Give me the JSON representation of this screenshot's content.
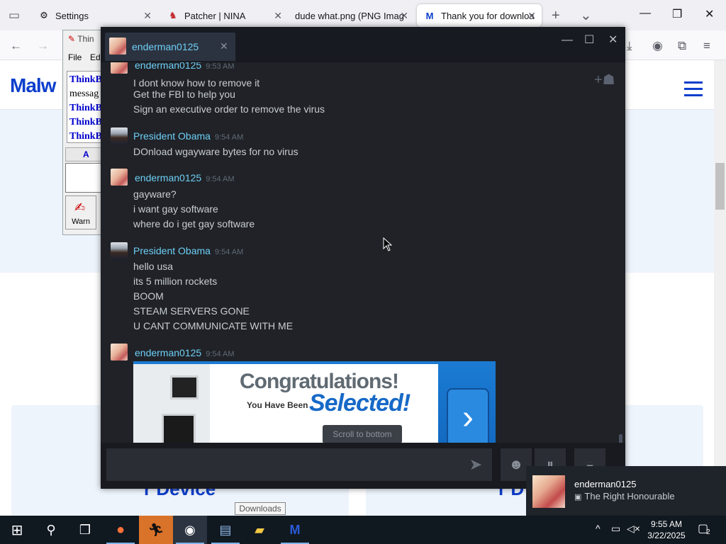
{
  "browser": {
    "tabs": [
      {
        "label": "Settings",
        "icon": "gear-icon"
      },
      {
        "label": "Patcher | NINA",
        "icon": "nina-icon"
      },
      {
        "label": "dude what.png (PNG Imag",
        "icon": "image-icon"
      },
      {
        "label": "Thank you for downloa",
        "icon": "malwarebytes-icon"
      }
    ],
    "new_tab": "+",
    "tab_list": "⌄"
  },
  "page": {
    "logo": "Malw",
    "card_left_title": "r Device",
    "card_right_title": "r D"
  },
  "thinkboard": {
    "title": "Thin",
    "menu_file": "File",
    "menu_edit": "Edi",
    "log_lines": [
      "ThinkB",
      "messag",
      "ThinkB",
      "ThinkB",
      "ThinkB"
    ],
    "bar_letter": "A",
    "warn_label": "Warn"
  },
  "steam": {
    "tab_name": "enderman0125",
    "close": "✕",
    "messages": [
      {
        "author": "enderman0125",
        "time": "9:53 AM",
        "kind": "ender",
        "lines": [
          "I dont know how to remove it",
          "Get the FBI to help you",
          "Sign an executive order to remove the virus"
        ]
      },
      {
        "author": "President Obama",
        "time": "9:54 AM",
        "kind": "obama",
        "lines": [
          "DOnload wgayware bytes for no virus"
        ]
      },
      {
        "author": "enderman0125",
        "time": "9:54 AM",
        "kind": "ender",
        "lines": [
          "gayware?",
          "i want gay software",
          "where do i get gay software"
        ]
      },
      {
        "author": "President Obama",
        "time": "9:54 AM",
        "kind": "obama",
        "lines": [
          "hello usa",
          "its 5 million rockets",
          "BOOM",
          "STEAM SERVERS GONE",
          "U CANT COMMUNICATE WITH ME"
        ]
      },
      {
        "author": "enderman0125",
        "time": "9:54 AM",
        "kind": "ender",
        "lines": []
      }
    ],
    "promo": {
      "headline": "Congratulations!",
      "subline": "You Have Been",
      "selected": "Selected!",
      "arrow": "›"
    },
    "scroll_to_bottom": "Scroll to bottom",
    "send_icon": "send-icon"
  },
  "tooltip": "Downloads",
  "toast": {
    "name": "enderman0125",
    "status": "The Right Honourable"
  },
  "taskbar": {
    "time": "9:55 AM",
    "date": "3/22/2025",
    "notification_count": "2"
  },
  "colors": {
    "steam_bg": "#202227",
    "steam_name": "#6dcff6",
    "brand_blue": "#0d3ecc",
    "taskbar": "#101820"
  }
}
